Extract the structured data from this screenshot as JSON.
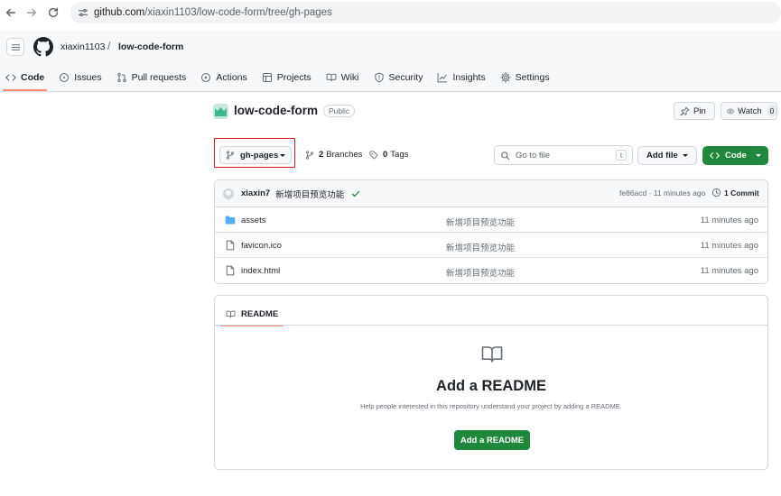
{
  "browser": {
    "url_host": "github.com",
    "url_path": "/xiaxin1103/low-code-form/tree/gh-pages"
  },
  "header": {
    "owner": "xiaxin1103",
    "separator": "/",
    "repo": "low-code-form"
  },
  "tabs": [
    {
      "label": "Code",
      "icon": "code-icon",
      "active": true
    },
    {
      "label": "Issues",
      "icon": "issue-icon"
    },
    {
      "label": "Pull requests",
      "icon": "pull-request-icon"
    },
    {
      "label": "Actions",
      "icon": "play-icon"
    },
    {
      "label": "Projects",
      "icon": "table-icon"
    },
    {
      "label": "Wiki",
      "icon": "book-icon"
    },
    {
      "label": "Security",
      "icon": "shield-icon"
    },
    {
      "label": "Insights",
      "icon": "graph-icon"
    },
    {
      "label": "Settings",
      "icon": "gear-icon"
    }
  ],
  "repo": {
    "title": "low-code-form",
    "visibility": "Public",
    "pin_label": "Pin",
    "watch_label": "Watch",
    "watch_count": "0"
  },
  "branch_bar": {
    "branch": "gh-pages",
    "branches_count": "2",
    "branches_label": "Branches",
    "tags_count": "0",
    "tags_label": "Tags",
    "goto_placeholder": "Go to file",
    "goto_shortcut": "t",
    "add_file_label": "Add file",
    "code_label": "Code"
  },
  "latest_commit": {
    "author": "xiaxin7",
    "message": "新增项目预览功能",
    "hash_time": "fe86acd · 11 minutes ago",
    "commit_count": "1 Commit"
  },
  "files": [
    {
      "name": "assets",
      "type": "folder",
      "message": "新增项目预览功能",
      "time": "11 minutes ago"
    },
    {
      "name": "favicon.ico",
      "type": "file",
      "message": "新增项目预览功能",
      "time": "11 minutes ago"
    },
    {
      "name": "index.html",
      "type": "file",
      "message": "新增项目预览功能",
      "time": "11 minutes ago"
    }
  ],
  "readme": {
    "tab_label": "README",
    "heading": "Add a README",
    "subtitle": "Help people interested in this repository understand your project by adding a README.",
    "button_label": "Add a README"
  },
  "colors": {
    "primary_green": "#1f883d",
    "active_tab_underline": "#fd8c73",
    "highlight_red": "#e02020",
    "folder_blue": "#54aeff"
  }
}
